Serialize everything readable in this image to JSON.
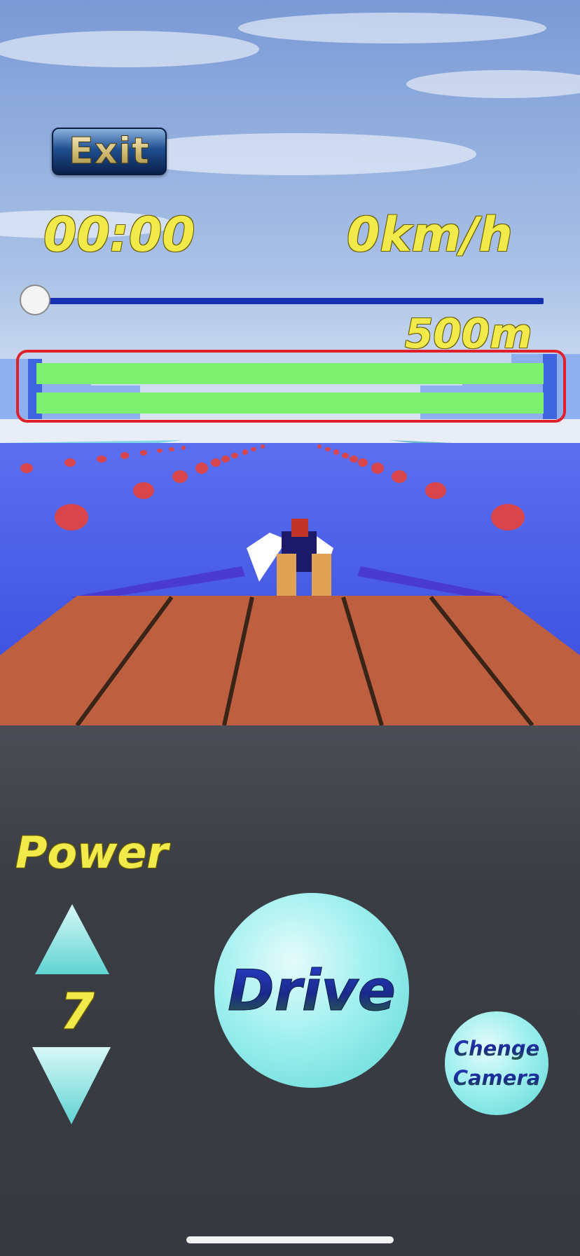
{
  "hud": {
    "exit_label": "Exit",
    "timer": "00:00",
    "speed": "0km/h",
    "remaining_distance": "500m",
    "progress": 0
  },
  "controls": {
    "power_label": "Power",
    "power_value": "7",
    "drive_label": "Drive",
    "camera_label_line1": "Chenge",
    "camera_label_line2": "Camera"
  },
  "colors": {
    "hud_text": "#f2e94a",
    "progress_track": "#1530b0",
    "green_bars": "#7ef070",
    "highlight": "#e0202a",
    "button_fill": "#9ff0ef"
  },
  "icons": {
    "power_up": "triangle-up-icon",
    "power_down": "triangle-down-icon"
  }
}
